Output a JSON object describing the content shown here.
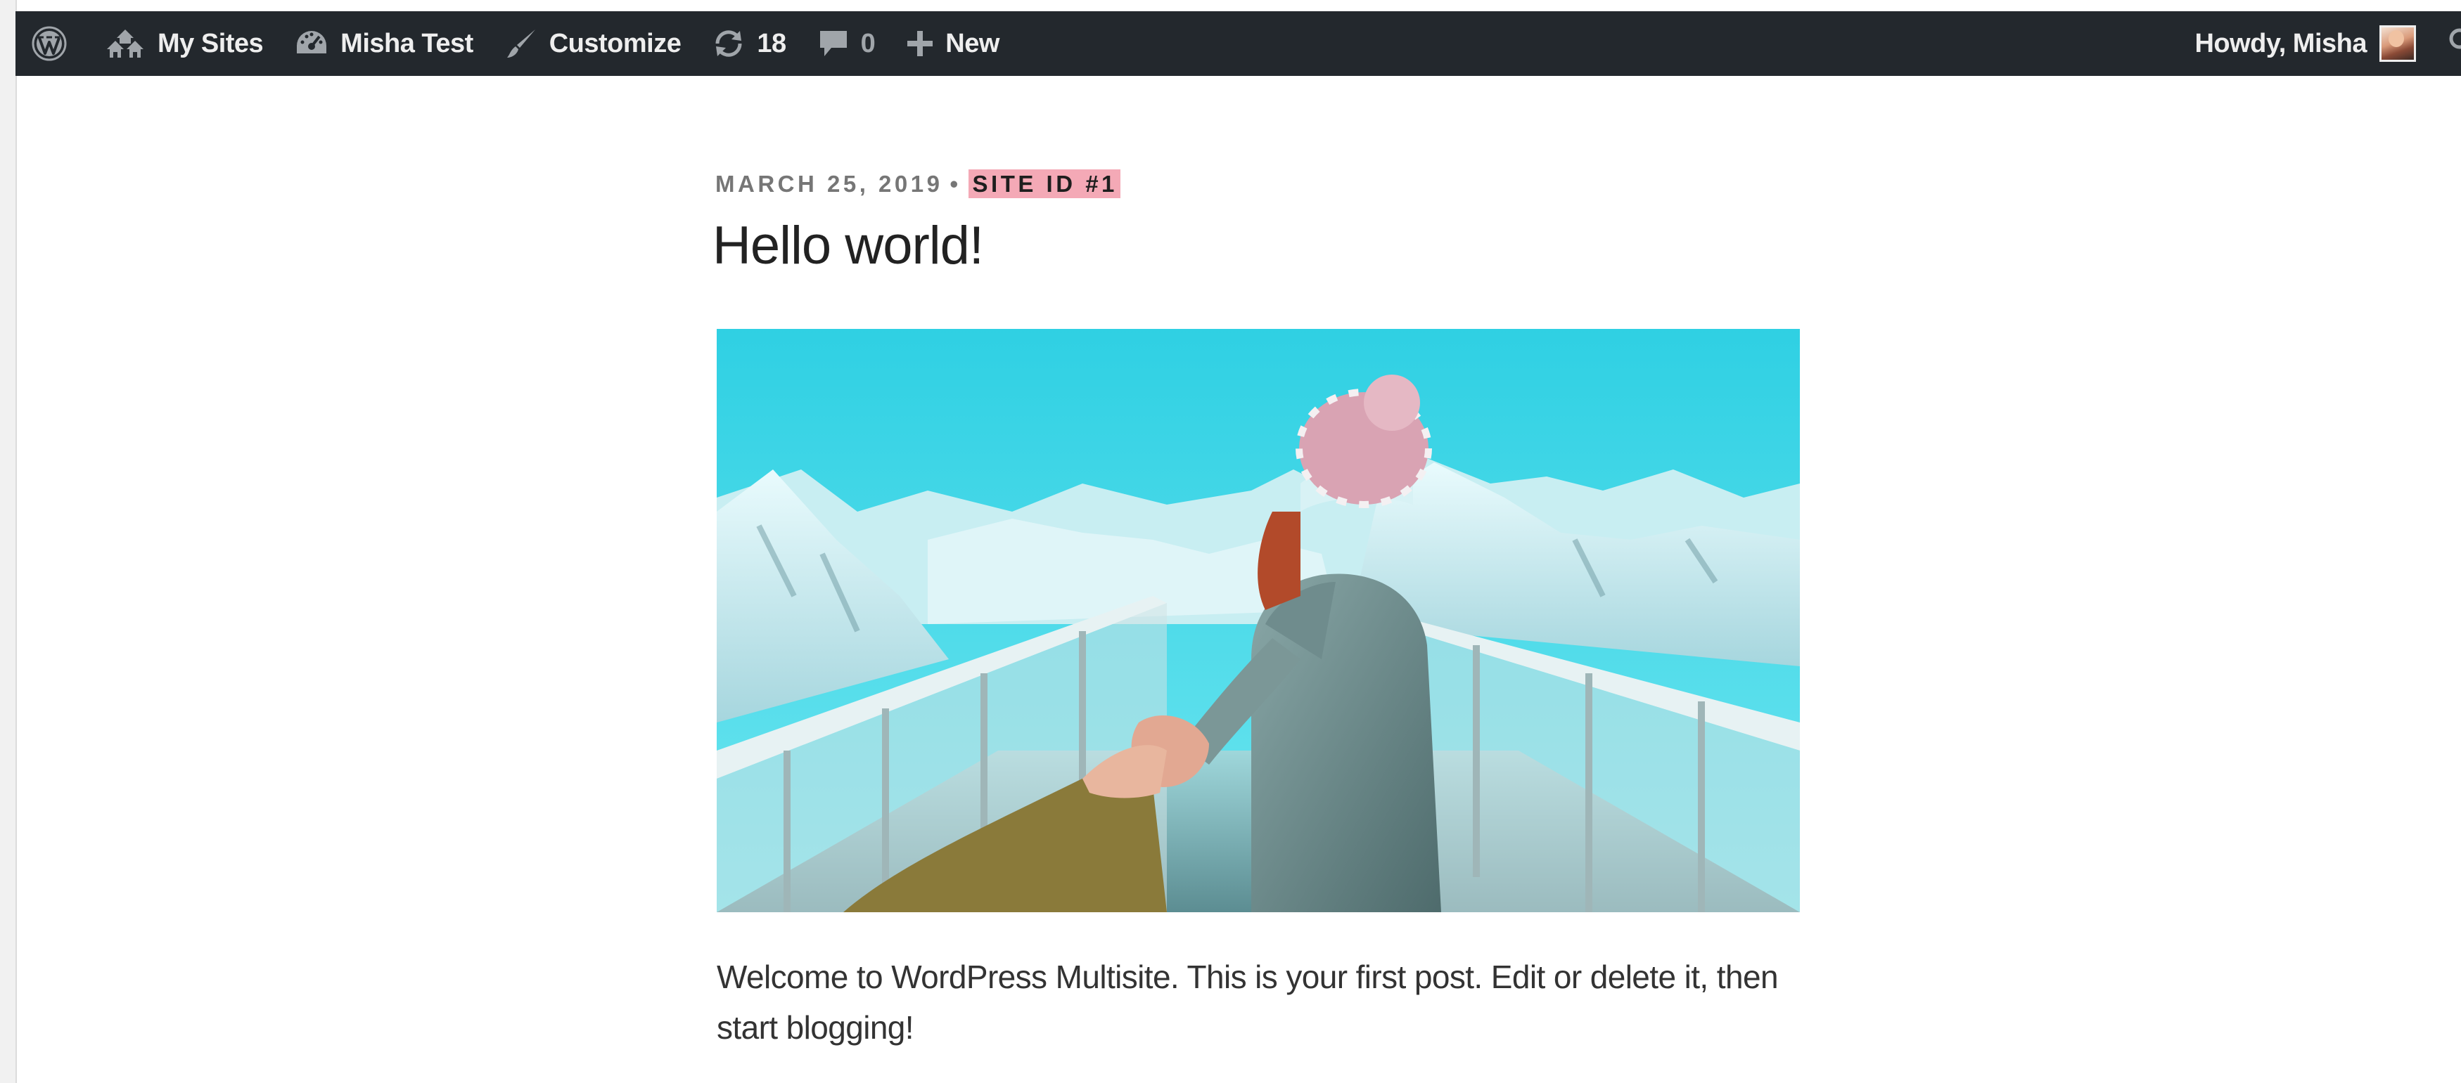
{
  "admin_bar": {
    "wp_logo_icon": "wordpress-logo-icon",
    "my_sites_label": "My Sites",
    "site_name_label": "Misha Test",
    "customize_label": "Customize",
    "updates_count": "18",
    "comments_count": "0",
    "new_label": "New",
    "howdy_label": "Howdy, Misha"
  },
  "post": {
    "date": "MARCH 25, 2019",
    "separator": "•",
    "site_badge": "SITE ID #1",
    "title": "Hello world!",
    "featured_image": "woman-in-ski-gear-on-mountain-lookout-holding-hand",
    "content": "Welcome to WordPress Multisite. This is your first post. Edit or delete it, then start blogging!"
  },
  "colors": {
    "admin_bar_bg": "#23282d",
    "admin_bar_text": "#eeeeee",
    "admin_bar_icon": "#a0a5aa",
    "badge_bg": "#f4a9b6",
    "meta_text": "#767676",
    "title_text": "#222222"
  }
}
